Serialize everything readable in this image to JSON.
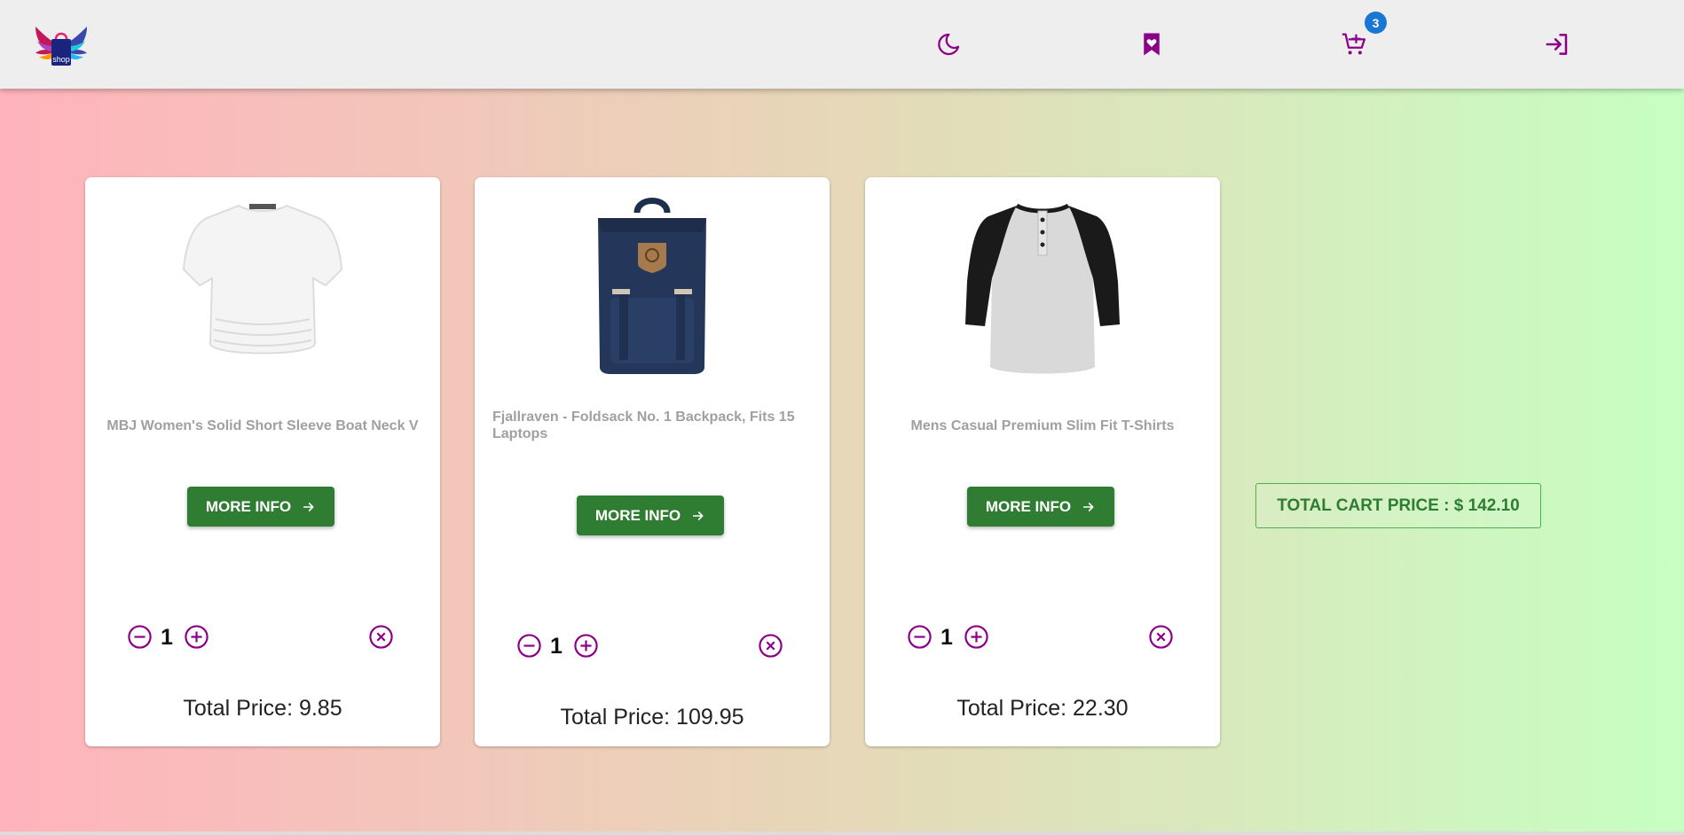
{
  "header": {
    "logo_text": "shop",
    "icons": [
      "moon-icon",
      "bookmark-heart-icon",
      "cart-plus-icon",
      "login-icon"
    ],
    "cart_count": "3",
    "accent_color": "#8b0087"
  },
  "cart": {
    "items": [
      {
        "title": "MBJ Women's Solid Short Sleeve Boat Neck V",
        "button_label": "MORE INFO",
        "quantity": "1",
        "total_price": "Total Price: 9.85"
      },
      {
        "title": "Fjallraven - Foldsack No. 1 Backpack, Fits 15 Laptops",
        "button_label": "MORE INFO",
        "quantity": "1",
        "total_price": "Total Price: 109.95"
      },
      {
        "title": "Mens Casual Premium Slim Fit T-Shirts",
        "button_label": "MORE INFO",
        "quantity": "1",
        "total_price": "Total Price: 22.30"
      }
    ],
    "total_label": "TOTAL CART PRICE : $ 142.10",
    "button_color": "#2e7d32"
  }
}
